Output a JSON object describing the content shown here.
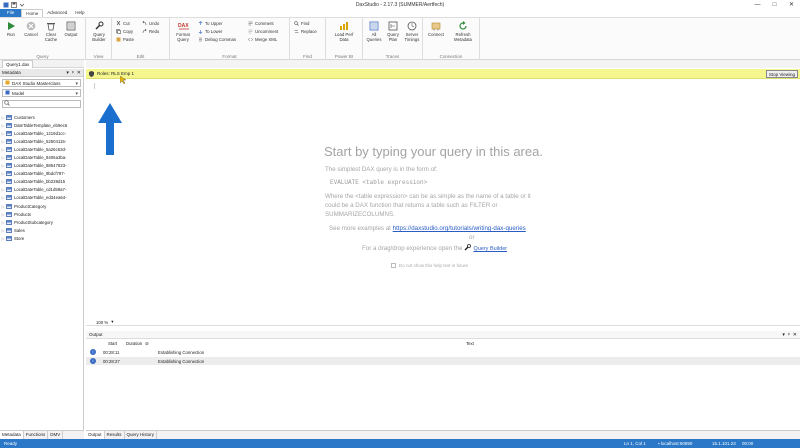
{
  "window": {
    "title": "DaxStudio - 2.17.3 (SUMMER/Aertfech)",
    "controls": [
      "—",
      "□",
      "✕"
    ]
  },
  "ribbon_tabs": [
    "File",
    "Home",
    "Advanced",
    "Help"
  ],
  "ribbon": {
    "query": {
      "label": "Query",
      "run": "Run",
      "cancel": "Cancel",
      "clear_cache": "Clear Cache",
      "output": "Output"
    },
    "view": {
      "label": "View",
      "query_builder": "Query Builder"
    },
    "edit": {
      "label": "Edit",
      "cut": "Cut",
      "copy": "Copy",
      "paste": "Paste",
      "undo": "Undo",
      "redo": "Redo"
    },
    "format": {
      "label": "Format",
      "format_query": "Format Query",
      "to_upper": "To Upper",
      "to_lower": "To Lower",
      "debug_commas": "Debug Commas",
      "comment": "Comment",
      "uncomment": "Uncomment",
      "merge_xml": "Merge XML"
    },
    "find": {
      "label": "Find",
      "find": "Find",
      "replace": "Replace"
    },
    "powerbi": {
      "label": "Power BI",
      "load_perf_data": "Load Perf Data"
    },
    "traces": {
      "label": "Traces",
      "all_queries": "All Queries",
      "query_plan": "Query Plan",
      "server_timings": "Server Timings"
    },
    "connection": {
      "label": "Connection",
      "connect": "Connect",
      "refresh_metadata": "Refresh Metadata"
    }
  },
  "left": {
    "doc_tab": "Query1.dax",
    "header": "Metadata",
    "header_controls": [
      "▾",
      "ᵖ",
      "✕"
    ],
    "database": "DAX Studio Masterclass",
    "model": "Model",
    "tables": [
      "Customers",
      "DateTableTemplate_eb9ec6",
      "LocalDateTable_1219d1cc-",
      "LocalDateTable_52504115-",
      "LocalDateTable_5a26c63d-",
      "LocalDateTable_8406a3ba-",
      "LocalDateTable_88547823-",
      "LocalDateTable_9bdcf787-",
      "LocalDateTable_bb239d15",
      "LocalDateTable_cd1d59a7-",
      "LocalDateTable_ed34ea64-",
      "ProductCategory",
      "Products",
      "ProductSubcategory",
      "Sales",
      "Store"
    ],
    "bottom_tabs": [
      "Metadata",
      "Functions",
      "DMV"
    ]
  },
  "editor": {
    "rls_text": "Roles: RLS Emp 1",
    "stop_viewing": "Stop Viewing",
    "help_title": "Start by typing your query in this area.",
    "help_line1": "The simplest DAX query is in the form of:",
    "help_code": "EVALUATE <table expression>",
    "help_line2": "Where the <table expression> can be as simple as the name of a table or it",
    "help_line3": "could be a DAX function that returns a table such as FILTER or",
    "help_line4": "SUMMARIZECOLUMNS.",
    "help_more_prefix": "See more examples at",
    "help_link": "https://daxstudio.org/tutorials/writing-dax-queries",
    "help_or": "or",
    "help_dragdrop": "For a drag/drop experience open the",
    "help_qb_link": "Query Builder",
    "checkbox_label": "Do not show this help text in future",
    "zoom": "100 %"
  },
  "output": {
    "header": "Output",
    "header_controls": [
      "▾",
      "ᵖ",
      "✕"
    ],
    "columns": [
      "Start",
      "Duration",
      "Text"
    ],
    "rows": [
      {
        "start": "00:28:11",
        "text": "Establishing Connection"
      },
      {
        "start": "00:28:27",
        "text": "Establishing Connection"
      }
    ],
    "bottom_tabs": [
      "Output",
      "Results",
      "Query History"
    ]
  },
  "status": {
    "left": "Ready",
    "position": "Ln 1, Col 1",
    "server": "localhost:60890",
    "version": "15.1.101.23",
    "time": "00:00"
  },
  "colors": {
    "accent": "#2b78c8",
    "rls_bar": "#f5f78e",
    "arrow": "#1a6fce"
  }
}
